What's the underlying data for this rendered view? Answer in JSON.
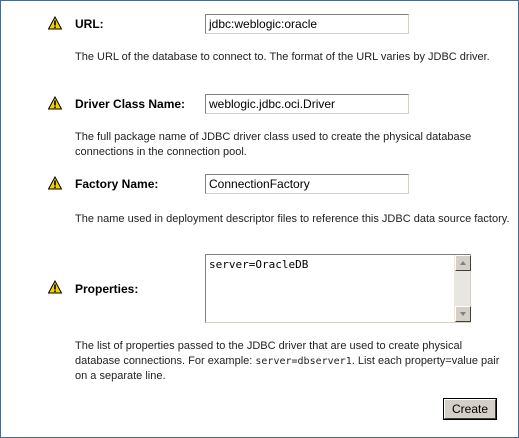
{
  "icons": {
    "warning": "warning-icon",
    "scroll_up": "scroll-up-arrow-icon",
    "scroll_down": "scroll-down-arrow-icon"
  },
  "colors": {
    "warning_fill": "#f0d000",
    "border": "#4a6a8c",
    "button_face": "#d4d0c8"
  },
  "fields": {
    "url": {
      "label": "URL:",
      "value": "jdbc:weblogic:oracle",
      "description": "The URL of the database to connect to. The format of the URL varies by JDBC driver."
    },
    "driver": {
      "label": "Driver Class Name:",
      "value": "weblogic.jdbc.oci.Driver",
      "description": "The full package name of JDBC driver class used to create the physical database connections in the connection pool."
    },
    "factory": {
      "label": "Factory Name:",
      "value": "ConnectionFactory",
      "description": "The name used in deployment descriptor files to reference this JDBC data source factory."
    },
    "properties": {
      "label": "Properties:",
      "value": "server=OracleDB",
      "description_before": "The list of properties passed to the JDBC driver that are used to create physical database connections. For example: ",
      "description_code": "server=dbserver1",
      "description_after": ". List each property=value pair on a separate line."
    }
  },
  "actions": {
    "create_label": "Create"
  }
}
